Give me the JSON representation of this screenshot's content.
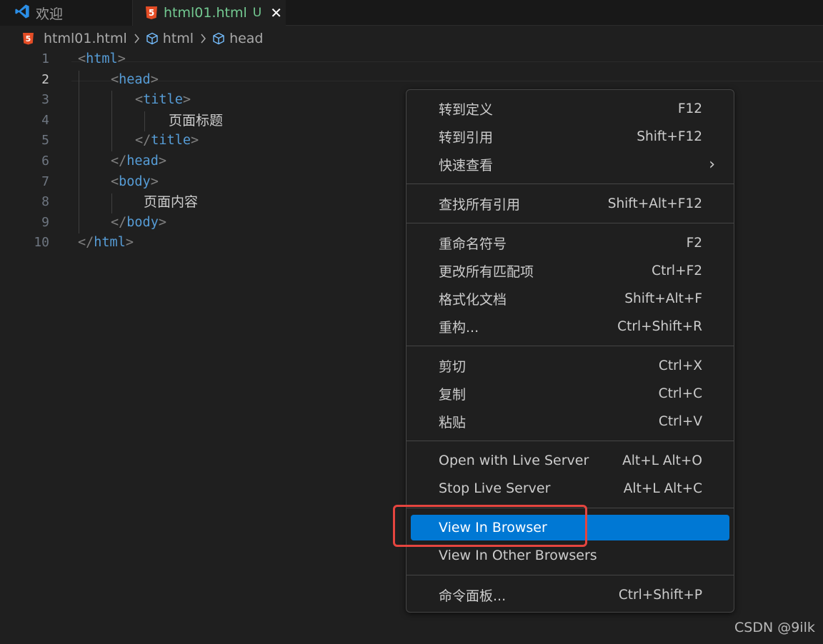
{
  "tabs": [
    {
      "label": "欢迎",
      "icon": "vscode-logo-icon"
    },
    {
      "label": "html01.html",
      "status": "U",
      "close": "✕",
      "icon": "html5-icon"
    }
  ],
  "breadcrumb": {
    "file": "html01.html",
    "items": [
      "html",
      "head"
    ]
  },
  "editor": {
    "current_line": 2,
    "line_numbers": [
      "1",
      "2",
      "3",
      "4",
      "5",
      "6",
      "7",
      "8",
      "9",
      "10"
    ],
    "lines": [
      {
        "open": "<",
        "tag": "html",
        "close": ">"
      },
      {
        "open": "<",
        "tag": "head",
        "close": ">"
      },
      {
        "open": "<",
        "tag": "title",
        "close": ">"
      },
      {
        "text": "页面标题"
      },
      {
        "open": "</",
        "tag": "title",
        "close": ">"
      },
      {
        "open": "</",
        "tag": "head",
        "close": ">"
      },
      {
        "open": "<",
        "tag": "body",
        "close": ">"
      },
      {
        "text": "页面内容"
      },
      {
        "open": "</",
        "tag": "body",
        "close": ">"
      },
      {
        "open": "</",
        "tag": "html",
        "close": ">"
      }
    ]
  },
  "context_menu": {
    "groups": [
      [
        {
          "label": "转到定义",
          "shortcut": "F12"
        },
        {
          "label": "转到引用",
          "shortcut": "Shift+F12"
        },
        {
          "label": "快速查看",
          "submenu": "›"
        }
      ],
      [
        {
          "label": "查找所有引用",
          "shortcut": "Shift+Alt+F12"
        }
      ],
      [
        {
          "label": "重命名符号",
          "shortcut": "F2"
        },
        {
          "label": "更改所有匹配项",
          "shortcut": "Ctrl+F2"
        },
        {
          "label": "格式化文档",
          "shortcut": "Shift+Alt+F"
        },
        {
          "label": "重构...",
          "shortcut": "Ctrl+Shift+R"
        }
      ],
      [
        {
          "label": "剪切",
          "shortcut": "Ctrl+X"
        },
        {
          "label": "复制",
          "shortcut": "Ctrl+C"
        },
        {
          "label": "粘贴",
          "shortcut": "Ctrl+V"
        }
      ],
      [
        {
          "label": "Open with Live Server",
          "shortcut": "Alt+L Alt+O"
        },
        {
          "label": "Stop Live Server",
          "shortcut": "Alt+L Alt+C"
        }
      ],
      [
        {
          "label": "View In Browser",
          "shortcut": "",
          "selected": true
        },
        {
          "label": "View In Other Browsers",
          "shortcut": ""
        }
      ],
      [
        {
          "label": "命令面板...",
          "shortcut": "Ctrl+Shift+P"
        }
      ]
    ]
  },
  "colors": {
    "background": "#1f1f1f",
    "tag": "#569cd6",
    "selected": "#0078d4",
    "annotation": "#e5453f",
    "untracked": "#73c991"
  },
  "watermark": "CSDN @9ilk"
}
